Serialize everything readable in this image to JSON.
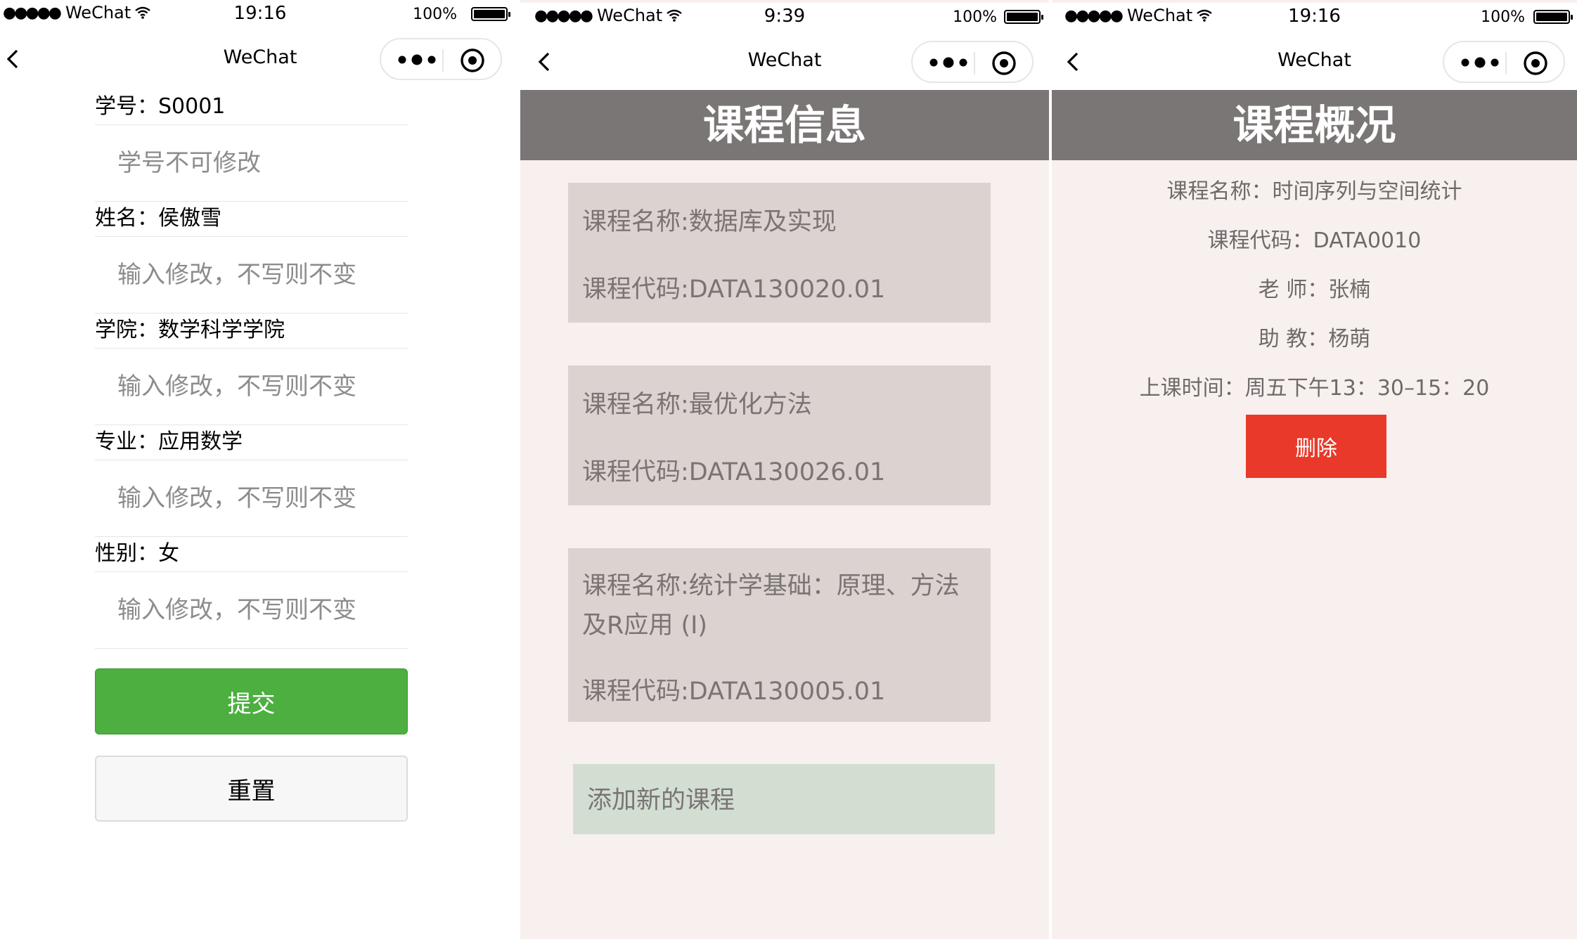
{
  "phones": [
    {
      "status": {
        "carrier": "WeChat",
        "time": "19:16",
        "battery": "100%"
      },
      "nav": {
        "title": "WeChat"
      }
    },
    {
      "status": {
        "carrier": "WeChat",
        "time": "9:39",
        "battery": "100%"
      },
      "nav": {
        "title": "WeChat"
      }
    },
    {
      "status": {
        "carrier": "WeChat",
        "time": "19:16",
        "battery": "100%"
      },
      "nav": {
        "title": "WeChat"
      }
    }
  ],
  "profile_form": {
    "fields": [
      {
        "label": "学号：S0001",
        "placeholder": "学号不可修改"
      },
      {
        "label": "姓名：侯傲雪",
        "placeholder": "输入修改，不写则不变"
      },
      {
        "label": "学院：数学科学学院",
        "placeholder": "输入修改，不写则不变"
      },
      {
        "label": "专业：应用数学",
        "placeholder": "输入修改，不写则不变"
      },
      {
        "label": "性别：女",
        "placeholder": "输入修改，不写则不变"
      }
    ],
    "submit_label": "提交",
    "reset_label": "重置",
    "submit_color": "#4caf3f"
  },
  "course_list": {
    "header": "课程信息",
    "courses": [
      {
        "name": "课程名称:数据库及实现",
        "code": "课程代码:DATA130020.01"
      },
      {
        "name": "课程名称:最优化方法",
        "code": "课程代码:DATA130026.01"
      },
      {
        "name": "课程名称:统计学基础：原理、方法及R应用 (I)",
        "code": "课程代码:DATA130005.01"
      }
    ],
    "add_label": "添加新的课程"
  },
  "course_overview": {
    "header": "课程概况",
    "lines": [
      "课程名称：时间序列与空间统计",
      "课程代码：DATA0010",
      "老 师：张楠",
      "助 教：杨萌",
      "上课时间：周五下午13：30–15：20"
    ],
    "delete_label": "删除",
    "delete_color": "#e8392a"
  },
  "icons": {
    "back": "chevron-left-icon",
    "more": "more-dots-icon",
    "close_target": "target-circle-icon",
    "wifi": "wifi-icon",
    "battery": "battery-icon"
  }
}
